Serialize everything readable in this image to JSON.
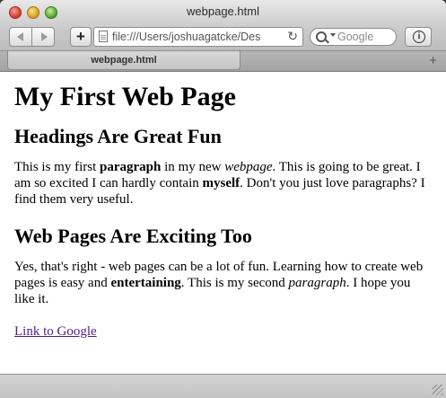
{
  "window": {
    "title": "webpage.html"
  },
  "toolbar": {
    "back_icon": "chevron-left-icon",
    "forward_icon": "chevron-right-icon",
    "add_bookmark_label": "+",
    "url": "file:///Users/joshuagatcke/Des",
    "reload_icon": "reload-icon",
    "search_placeholder": "Google",
    "info_icon": "info-icon"
  },
  "tabs": [
    {
      "label": "webpage.html"
    }
  ],
  "page": {
    "h1": "My First Web Page",
    "sections": [
      {
        "heading": "Headings Are Great Fun",
        "paragraph": [
          {
            "text": "This is my first ",
            "style": "normal"
          },
          {
            "text": "paragraph",
            "style": "bold"
          },
          {
            "text": " in my new ",
            "style": "normal"
          },
          {
            "text": "webpage",
            "style": "italic"
          },
          {
            "text": ". This is going to be great. I am so excited I can hardly contain ",
            "style": "normal"
          },
          {
            "text": "myself",
            "style": "bold"
          },
          {
            "text": ". Don't you just love paragraphs? I find them very useful.",
            "style": "normal"
          }
        ]
      },
      {
        "heading": "Web Pages Are Exciting Too",
        "paragraph": [
          {
            "text": "Yes, that's right - web pages can be a lot of fun. Learning how to create web pages is easy and ",
            "style": "normal"
          },
          {
            "text": "entertaining",
            "style": "bold"
          },
          {
            "text": ". This is my second ",
            "style": "normal"
          },
          {
            "text": "paragraph",
            "style": "italic"
          },
          {
            "text": ". I hope you like it.",
            "style": "normal"
          }
        ]
      }
    ],
    "link": "Link to Google",
    "link_color": "#551a8b"
  }
}
